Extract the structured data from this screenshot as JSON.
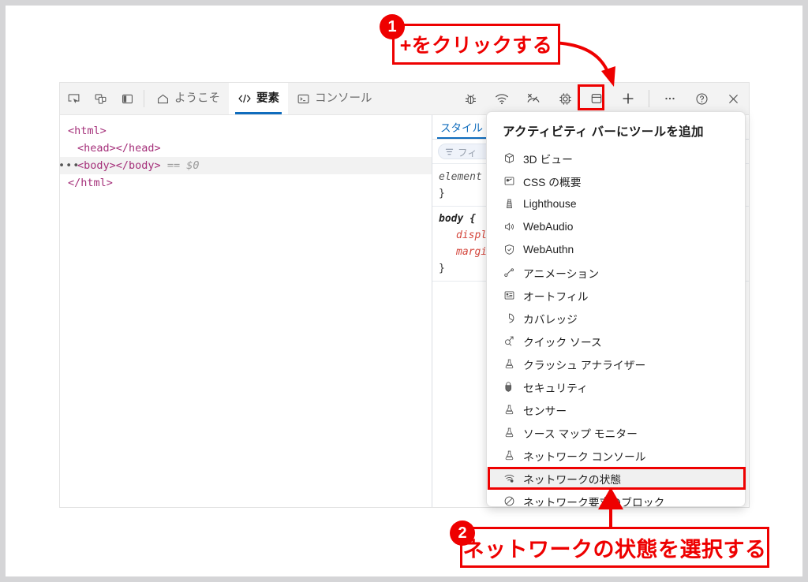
{
  "devtools": {
    "left_toolbar_icons": [
      "inspect-element-icon",
      "device-emulation-icon",
      "dock-side-icon"
    ],
    "tabs": [
      {
        "label": "ようこそ",
        "icon": "home-icon",
        "active": false
      },
      {
        "label": "要素",
        "icon": "code-brackets-icon",
        "active": true
      },
      {
        "label": "コンソール",
        "icon": "terminal-icon",
        "active": false
      }
    ],
    "right_icons": [
      "bug-icon",
      "wifi-icon",
      "performance-icon",
      "cpu-icon",
      "application-icon",
      "plus-icon"
    ],
    "window_icons": [
      "more-options-icon",
      "help-icon",
      "close-icon"
    ],
    "dom_tree": [
      {
        "text": "<html>",
        "indent": 0,
        "selected": false,
        "suffix": ""
      },
      {
        "text": "<head></head>",
        "indent": 1,
        "selected": false,
        "suffix": ""
      },
      {
        "text": "<body></body>",
        "indent": 1,
        "selected": true,
        "suffix": "== $0"
      },
      {
        "text": "</html>",
        "indent": 0,
        "selected": false,
        "suffix": ""
      }
    ],
    "styles": {
      "tab_label": "スタイル",
      "filter_placeholder": "フィ",
      "css_lines": [
        {
          "text": "element",
          "kind": "selector"
        },
        {
          "text": "}",
          "kind": "brace"
        },
        {
          "text": "body {",
          "kind": "selector-bold"
        },
        {
          "text": "displ",
          "kind": "property"
        },
        {
          "text": "margi",
          "kind": "property"
        },
        {
          "text": "}",
          "kind": "brace"
        }
      ]
    }
  },
  "dropdown": {
    "title": "アクティビティ バーにツールを追加",
    "items": [
      {
        "label": "3D ビュー",
        "icon": "cube-3d-icon",
        "highlighted": false
      },
      {
        "label": "CSS の概要",
        "icon": "css-overview-icon",
        "highlighted": false
      },
      {
        "label": "Lighthouse",
        "icon": "lighthouse-icon",
        "highlighted": false
      },
      {
        "label": "WebAudio",
        "icon": "speaker-icon",
        "highlighted": false
      },
      {
        "label": "WebAuthn",
        "icon": "shield-check-icon",
        "highlighted": false
      },
      {
        "label": "アニメーション",
        "icon": "animation-icon",
        "highlighted": false
      },
      {
        "label": "オートフィル",
        "icon": "autofill-form-icon",
        "highlighted": false
      },
      {
        "label": "カバレッジ",
        "icon": "coverage-pie-icon",
        "highlighted": false
      },
      {
        "label": "クイック ソース",
        "icon": "quick-source-icon",
        "highlighted": false
      },
      {
        "label": "クラッシュ アナライザー",
        "icon": "experiment-icon",
        "highlighted": false
      },
      {
        "label": "セキュリティ",
        "icon": "lock-shield-icon",
        "highlighted": false
      },
      {
        "label": "センサー",
        "icon": "experiment-icon",
        "highlighted": false
      },
      {
        "label": "ソース マップ モニター",
        "icon": "experiment-icon",
        "highlighted": false
      },
      {
        "label": "ネットワーク コンソール",
        "icon": "experiment-icon",
        "highlighted": false
      },
      {
        "label": "ネットワークの状態",
        "icon": "network-conditions-icon",
        "highlighted": true
      },
      {
        "label": "ネットワーク要求のブロック",
        "icon": "block-icon",
        "highlighted": false
      }
    ]
  },
  "annotations": {
    "step1": {
      "number": "1",
      "text": "+をクリックする"
    },
    "step2": {
      "number": "2",
      "text": "ネットワークの状態を選択する"
    },
    "accent_color": "#ee0000"
  }
}
